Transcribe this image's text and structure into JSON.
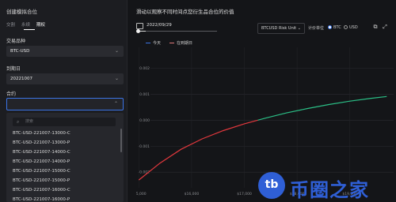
{
  "panel": {
    "title": "创建模拟合位",
    "tabs": [
      "交割",
      "永续",
      "期权"
    ],
    "instrument_label": "交易品种",
    "instrument_value": "BTC-USD",
    "expiry_label": "到期日",
    "expiry_value": "20221007",
    "contract_label": "合约",
    "contract_value": "",
    "search_placeholder": "搜索",
    "options": [
      "BTC-USD-221007-13000-C",
      "BTC-USD-221007-13000-P",
      "BTC-USD-221007-14000-C",
      "BTC-USD-221007-14000-P",
      "BTC-USD-221007-15000-C",
      "BTC-USD-221007-15000-P",
      "BTC-USD-221007-16000-C",
      "BTC-USD-221007-16000-P"
    ]
  },
  "main": {
    "title": "滑动以观察不同时间点您衍生品合位的价值",
    "date": "2022/09/29",
    "unit_select": "BTCUSD Risk Unit",
    "price_unit_label": "计价单位",
    "radio_btc": "BTC",
    "radio_usd": "USD",
    "slider_fraction": 0.1,
    "legend_today": "今天",
    "legend_expiry": "在到期日"
  },
  "chart_data": {
    "type": "line",
    "y_ticks": [
      "0.002",
      "0.001",
      "0.000",
      "-0.001",
      "-0.002"
    ],
    "x_ticks": [
      "$15,000",
      "$16,000",
      "$17,000",
      "$18,000",
      "$19,000"
    ],
    "ylim": [
      -0.0026,
      0.0028
    ],
    "xlim": [
      14950,
      19800
    ],
    "series": [
      {
        "name": "今天",
        "points": [
          [
            15000,
            -0.0023
          ],
          [
            15400,
            -0.00165
          ],
          [
            15800,
            -0.00112
          ],
          [
            16200,
            -0.00072
          ],
          [
            16600,
            -0.0004
          ],
          [
            17000,
            -0.00014
          ],
          [
            17400,
            8e-05
          ],
          [
            17800,
            0.00028
          ],
          [
            18200,
            0.00045
          ],
          [
            18600,
            0.0006
          ],
          [
            19000,
            0.00073
          ],
          [
            19400,
            0.00084
          ],
          [
            19700,
            0.00091
          ]
        ]
      }
    ],
    "colors": {
      "negative": "#e2383d",
      "positive": "#2bbf86",
      "expiry": "#e07a7a"
    }
  },
  "watermark": {
    "circle_text": "tb",
    "brand_text": "币圈之家"
  }
}
